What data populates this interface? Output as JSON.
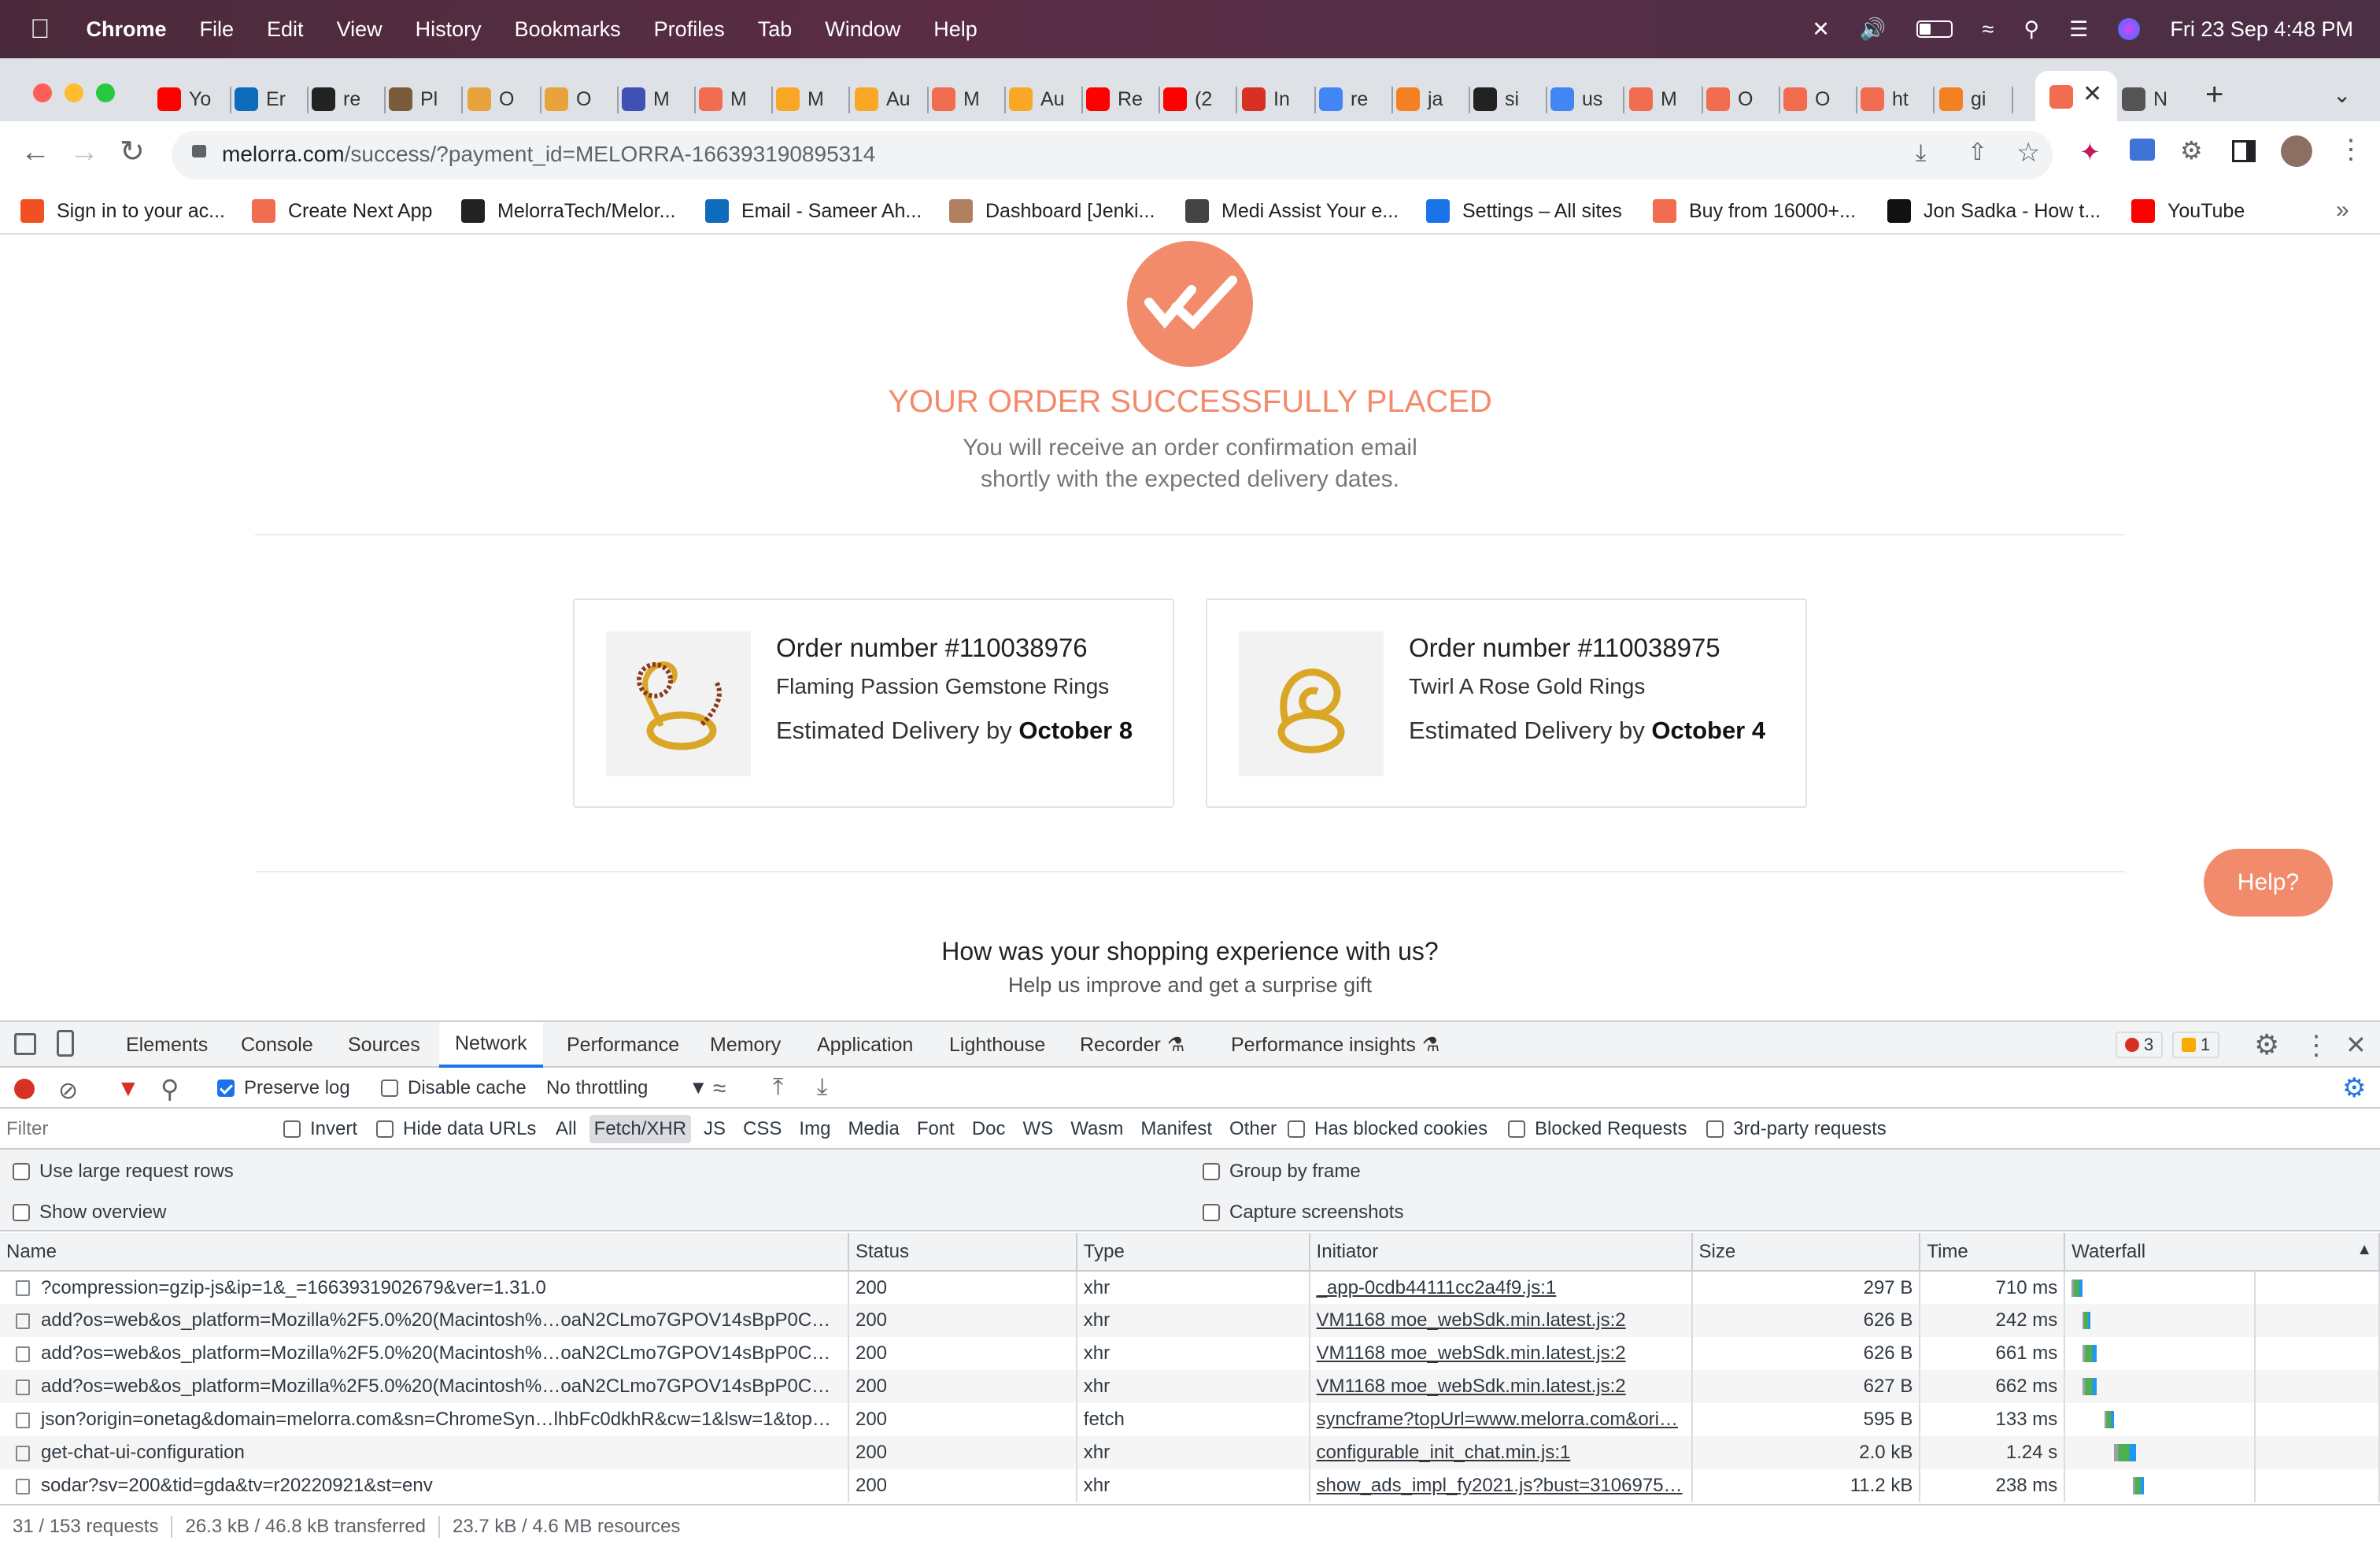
{
  "menubar": {
    "app": "Chrome",
    "items": [
      "File",
      "Edit",
      "View",
      "History",
      "Bookmarks",
      "Profiles",
      "Tab",
      "Window",
      "Help"
    ],
    "clock": "Fri 23 Sep  4:48 PM"
  },
  "tabs": [
    {
      "label": "Yo",
      "color": "#ff0000"
    },
    {
      "label": "Er",
      "color": "#0f6cbd"
    },
    {
      "label": "re",
      "color": "#222222"
    },
    {
      "label": "Pl",
      "color": "#7a5c3a"
    },
    {
      "label": "O",
      "color": "#e8a33c"
    },
    {
      "label": "O",
      "color": "#e8a33c"
    },
    {
      "label": "M",
      "color": "#3f51b5"
    },
    {
      "label": "M",
      "color": "#f26c4f"
    },
    {
      "label": "M",
      "color": "#f9a825"
    },
    {
      "label": "Au",
      "color": "#f9a825"
    },
    {
      "label": "M",
      "color": "#f26c4f"
    },
    {
      "label": "Au",
      "color": "#f9a825"
    },
    {
      "label": "Re",
      "color": "#ff0000"
    },
    {
      "label": "(2",
      "color": "#ff0000"
    },
    {
      "label": "In",
      "color": "#d93025"
    },
    {
      "label": "re",
      "color": "#4285f4"
    },
    {
      "label": "ja",
      "color": "#f48024"
    },
    {
      "label": "si",
      "color": "#222222"
    },
    {
      "label": "us",
      "color": "#4285f4"
    },
    {
      "label": "M",
      "color": "#f26c4f"
    },
    {
      "label": "O",
      "color": "#f26c4f"
    },
    {
      "label": "O",
      "color": "#f26c4f"
    },
    {
      "label": "ht",
      "color": "#f26c4f"
    },
    {
      "label": "gi",
      "color": "#f48024"
    },
    {
      "label": "N",
      "color": "#555555"
    }
  ],
  "address": {
    "host": "melorra.com",
    "path": "/success/?payment_id=MELORRA-166393190895314"
  },
  "bookmarks": [
    {
      "label": "Sign in to your ac...",
      "color": "#f25022"
    },
    {
      "label": "Create Next App",
      "color": "#f26c4f"
    },
    {
      "label": "MelorraTech/Melor...",
      "color": "#222222"
    },
    {
      "label": "Email - Sameer Ah...",
      "color": "#0f6cbd"
    },
    {
      "label": "Dashboard [Jenki...",
      "color": "#b08060"
    },
    {
      "label": "Medi Assist Your e...",
      "color": "#444444"
    },
    {
      "label": "Settings – All sites",
      "color": "#1a73e8"
    },
    {
      "label": "Buy from 16000+...",
      "color": "#f26c4f"
    },
    {
      "label": "Jon Sadka - How t...",
      "color": "#111111"
    },
    {
      "label": "YouTube",
      "color": "#ff0000"
    }
  ],
  "page": {
    "headline": "YOUR ORDER SUCCESSFULLY PLACED",
    "subtext_1": "You will receive an order confirmation email",
    "subtext_2": "shortly with the expected delivery dates.",
    "accent": "#f28b6b",
    "orders": [
      {
        "number": "Order number #110038976",
        "product": "Flaming Passion Gemstone Rings",
        "delivery_prefix": "Estimated Delivery by ",
        "delivery_date": "October 8"
      },
      {
        "number": "Order number #110038975",
        "product": "Twirl A Rose Gold Rings",
        "delivery_prefix": "Estimated Delivery by ",
        "delivery_date": "October 4"
      }
    ],
    "help_button": "Help?",
    "survey_title": "How was your shopping experience with us?",
    "survey_sub": "Help us improve and get a surprise gift"
  },
  "devtools": {
    "tabs": [
      "Elements",
      "Console",
      "Sources",
      "Network",
      "Performance",
      "Memory",
      "Application",
      "Lighthouse",
      "Recorder",
      "Performance insights"
    ],
    "active_tab": "Network",
    "errors": "3",
    "warnings": "1",
    "preserve_log": "Preserve log",
    "disable_cache": "Disable cache",
    "throttling": "No throttling",
    "filter_placeholder": "Filter",
    "invert": "Invert",
    "hide_data_urls": "Hide data URLs",
    "types": [
      "All",
      "Fetch/XHR",
      "JS",
      "CSS",
      "Img",
      "Media",
      "Font",
      "Doc",
      "WS",
      "Wasm",
      "Manifest",
      "Other"
    ],
    "active_type": "Fetch/XHR",
    "has_blocked_cookies": "Has blocked cookies",
    "blocked_requests": "Blocked Requests",
    "third_party": "3rd-party requests",
    "use_large_rows": "Use large request rows",
    "show_overview": "Show overview",
    "group_by_frame": "Group by frame",
    "capture_screenshots": "Capture screenshots",
    "columns": [
      "Name",
      "Status",
      "Type",
      "Initiator",
      "Size",
      "Time",
      "Waterfall"
    ],
    "rows": [
      {
        "name": "?compression=gzip-js&ip=1&_=1663931902679&ver=1.31.0",
        "status": "200",
        "type": "xhr",
        "initiator": "_app-0cdb44111cc2a4f9.js:1",
        "size": "297 B",
        "time": "710 ms"
      },
      {
        "name": "add?os=web&os_platform=Mozilla%2F5.0%20(Macintosh%…oaN2CLmo7GPOV14sBpP0C…",
        "status": "200",
        "type": "xhr",
        "initiator": "VM1168 moe_webSdk.min.latest.js:2",
        "size": "626 B",
        "time": "242 ms"
      },
      {
        "name": "add?os=web&os_platform=Mozilla%2F5.0%20(Macintosh%…oaN2CLmo7GPOV14sBpP0C…",
        "status": "200",
        "type": "xhr",
        "initiator": "VM1168 moe_webSdk.min.latest.js:2",
        "size": "626 B",
        "time": "661 ms"
      },
      {
        "name": "add?os=web&os_platform=Mozilla%2F5.0%20(Macintosh%…oaN2CLmo7GPOV14sBpP0C…",
        "status": "200",
        "type": "xhr",
        "initiator": "VM1168 moe_webSdk.min.latest.js:2",
        "size": "627 B",
        "time": "662 ms"
      },
      {
        "name": "json?origin=onetag&domain=melorra.com&sn=ChromeSyn…lhbFc0dkhR&cw=1&lsw=1&top…",
        "status": "200",
        "type": "fetch",
        "initiator": "syncframe?topUrl=www.melorra.com&ori…",
        "size": "595 B",
        "time": "133 ms"
      },
      {
        "name": "get-chat-ui-configuration",
        "status": "200",
        "type": "xhr",
        "initiator": "configurable_init_chat.min.js:1",
        "size": "2.0 kB",
        "time": "1.24 s"
      },
      {
        "name": "sodar?sv=200&tid=gda&tv=r20220921&st=env",
        "status": "200",
        "type": "xhr",
        "initiator": "show_ads_impl_fy2021.js?bust=3106975…",
        "size": "11.2 kB",
        "time": "238 ms"
      }
    ],
    "status": {
      "requests": "31 / 153 requests",
      "transferred": "26.3 kB / 46.8 kB transferred",
      "resources": "23.7 kB / 4.6 MB resources"
    }
  }
}
